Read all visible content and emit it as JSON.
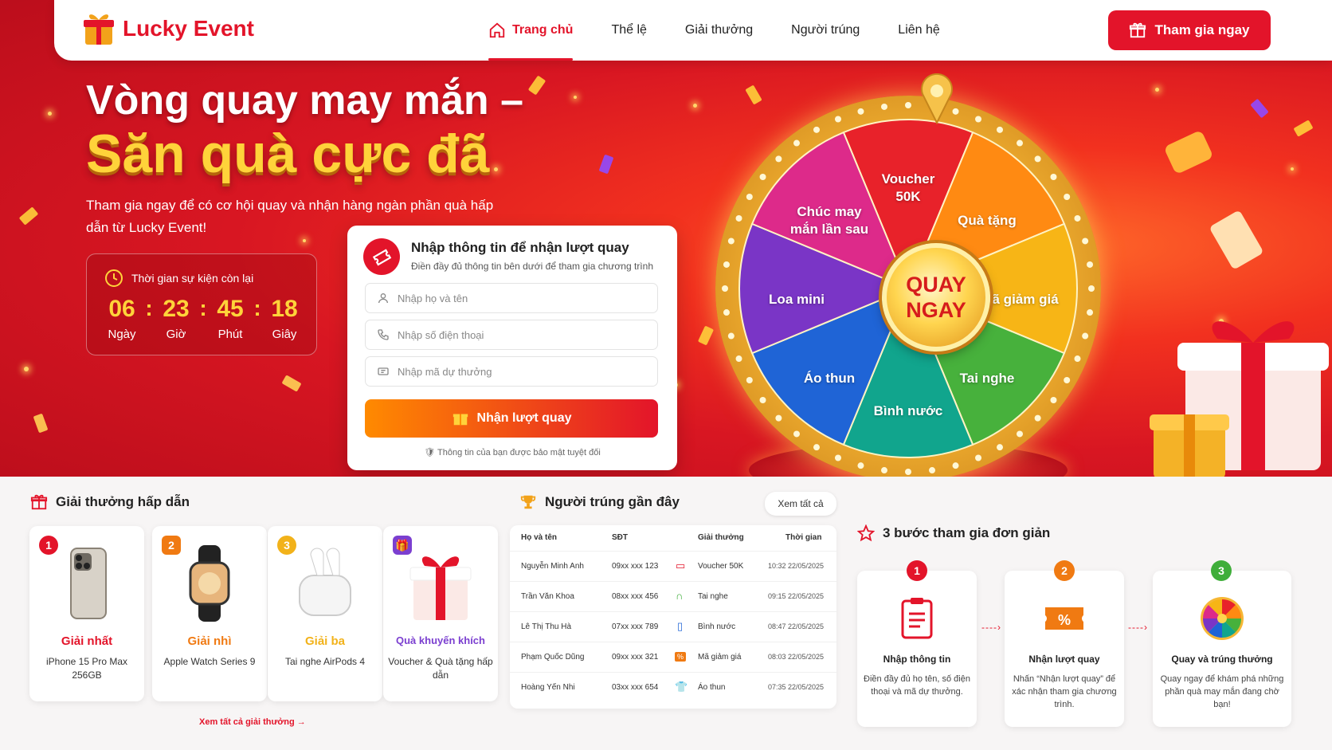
{
  "brand": {
    "name": "Lucky Event"
  },
  "nav": {
    "items": [
      {
        "label": "Trang chủ"
      },
      {
        "label": "Thể lệ"
      },
      {
        "label": "Giải thưởng"
      },
      {
        "label": "Người trúng"
      },
      {
        "label": "Liên hệ"
      }
    ],
    "join_label": "Tham gia ngay"
  },
  "hero": {
    "title_line1": "Vòng quay may mắn –",
    "title_line2": "Săn quà cực đã",
    "subtitle": "Tham gia ngay để có cơ hội quay và nhận hàng ngàn phần quà hấp dẫn từ Lucky Event!"
  },
  "countdown": {
    "title": "Thời gian sự kiện còn lại",
    "units": [
      {
        "value": "06",
        "label": "Ngày"
      },
      {
        "value": "23",
        "label": "Giờ"
      },
      {
        "value": "45",
        "label": "Phút"
      },
      {
        "value": "18",
        "label": "Giây"
      }
    ]
  },
  "form": {
    "title": "Nhập thông tin để nhận lượt quay",
    "subtitle": "Điền đầy đủ thông tin bên dưới để tham gia chương trình",
    "name_placeholder": "Nhập họ và tên",
    "phone_placeholder": "Nhập số điện thoại",
    "code_placeholder": "Nhập mã dự thưởng",
    "submit_label": "Nhận lượt quay",
    "secure_note": "Thông tin của bạn được bảo mật tuyệt đối"
  },
  "wheel": {
    "center_line1": "QUAY",
    "center_line2": "NGAY",
    "segments": [
      {
        "label": "Voucher\n50K",
        "color": "#e8222a"
      },
      {
        "label": "Quà tặng",
        "color": "#ff8a12"
      },
      {
        "label": "Mã giảm giá",
        "color": "#f7b516"
      },
      {
        "label": "Tai nghe",
        "color": "#47b13c"
      },
      {
        "label": "Bình nước",
        "color": "#11a58d"
      },
      {
        "label": "Áo thun",
        "color": "#1f64d6"
      },
      {
        "label": "Loa mini",
        "color": "#7a35c6"
      },
      {
        "label": "Chúc may\nmắn lần sau",
        "color": "#dd2a8a"
      }
    ]
  },
  "prizes": {
    "title": "Giải thưởng hấp dẫn",
    "see_all": "Xem tất cả giải thưởng",
    "items": [
      {
        "rank": "1",
        "name": "Giải nhất",
        "desc": "iPhone 15 Pro Max 256GB",
        "color": "#e3142a"
      },
      {
        "rank": "2",
        "name": "Giải nhì",
        "desc": "Apple Watch Series 9",
        "color": "#f07a12"
      },
      {
        "rank": "3",
        "name": "Giải ba",
        "desc": "Tai nghe AirPods 4",
        "color": "#f2b21a"
      },
      {
        "rank": "",
        "name": "Quà khuyến khích",
        "desc": "Voucher & Quà tặng hấp dẫn",
        "color": "#7b3fd0"
      }
    ]
  },
  "winners": {
    "title": "Người trúng gần đây",
    "see_all": "Xem tất cả",
    "headers": [
      "Họ và tên",
      "SĐT",
      "Giải thưởng",
      "Thời gian"
    ],
    "rows": [
      {
        "name": "Nguyễn Minh Anh",
        "phone": "09xx xxx 123",
        "prize": "Voucher 50K",
        "time": "10:32 22/05/2025",
        "icon": "voucher-icon"
      },
      {
        "name": "Trần Văn Khoa",
        "phone": "08xx xxx 456",
        "prize": "Tai nghe",
        "time": "09:15 22/05/2025",
        "icon": "headphone-icon"
      },
      {
        "name": "Lê Thị Thu Hà",
        "phone": "07xx xxx 789",
        "prize": "Bình nước",
        "time": "08:47 22/05/2025",
        "icon": "bottle-icon"
      },
      {
        "name": "Phạm Quốc Dũng",
        "phone": "09xx xxx 321",
        "prize": "Mã giảm giá",
        "time": "08:03 22/05/2025",
        "icon": "discount-icon"
      },
      {
        "name": "Hoàng Yến Nhi",
        "phone": "03xx xxx 654",
        "prize": "Áo thun",
        "time": "07:35 22/05/2025",
        "icon": "tshirt-icon"
      }
    ]
  },
  "steps": {
    "title": "3 bước tham gia đơn giản",
    "items": [
      {
        "num": "1",
        "title": "Nhập thông tin",
        "desc": "Điền đầy đủ họ tên, số điện thoại và mã dự thưởng.",
        "color": "#e3142a"
      },
      {
        "num": "2",
        "title": "Nhận lượt quay",
        "desc": "Nhấn “Nhận lượt quay” để xác nhận tham gia chương trình.",
        "color": "#f07a12"
      },
      {
        "num": "3",
        "title": "Quay và trúng thưởng",
        "desc": "Quay ngay để khám phá những phần quà may mắn đang chờ bạn!",
        "color": "#3fae3a"
      }
    ]
  }
}
